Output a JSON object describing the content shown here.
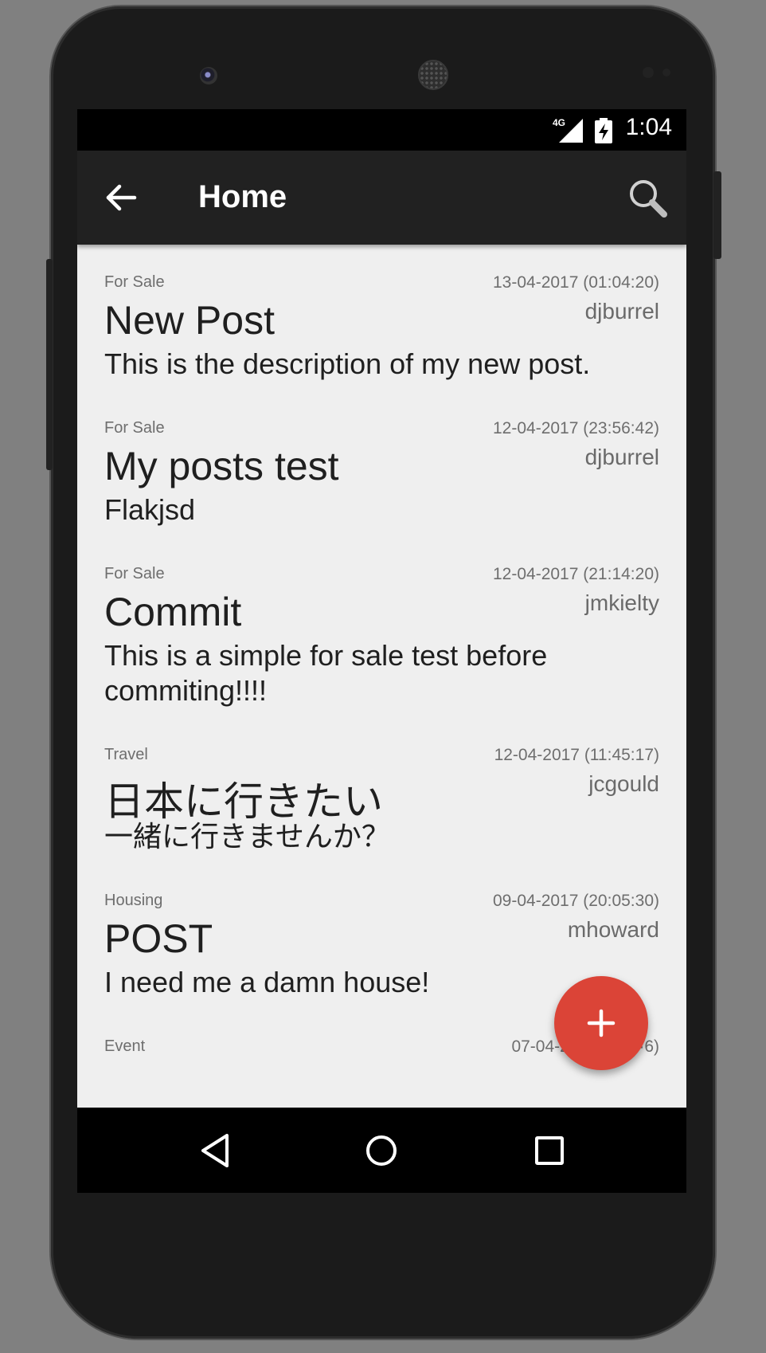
{
  "status_bar": {
    "network": "4G",
    "time": "1:04"
  },
  "app_bar": {
    "title": "Home",
    "back_icon": "arrow-left-icon",
    "search_icon": "search-icon"
  },
  "posts": [
    {
      "category": "For Sale",
      "date": "13-04-2017 (01:04:20)",
      "user": "djburrel",
      "title": "New Post",
      "description": "This is the description of my new post."
    },
    {
      "category": "For Sale",
      "date": "12-04-2017 (23:56:42)",
      "user": "djburrel",
      "title": "My posts test",
      "description": "Flakjsd"
    },
    {
      "category": "For Sale",
      "date": "12-04-2017 (21:14:20)",
      "user": "jmkielty",
      "title": "Commit",
      "description": "This is a simple for sale test before commiting!!!!"
    },
    {
      "category": "Travel",
      "date": "12-04-2017 (11:45:17)",
      "user": "jcgould",
      "title": "日本に行きたい",
      "description": "一緒に行きませんか？"
    },
    {
      "category": "Housing",
      "date": "09-04-2017 (20:05:30)",
      "user": "mhoward",
      "title": "POST",
      "description": "I need me a damn house!"
    },
    {
      "category": "Event",
      "date": "07-04-2017 (··:··:·6)"
    }
  ],
  "fab": {
    "icon": "plus-icon",
    "color": "#db4437"
  },
  "nav_bar": {
    "back_icon": "triangle-back-icon",
    "home_icon": "circle-home-icon",
    "recents_icon": "square-recents-icon"
  }
}
